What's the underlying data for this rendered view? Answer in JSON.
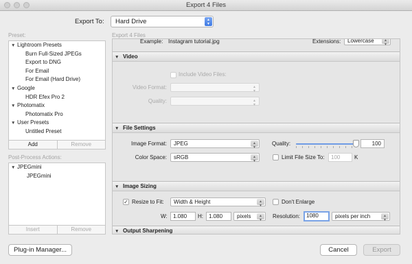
{
  "window": {
    "title": "Export 4 Files"
  },
  "export_to": {
    "label": "Export To:",
    "value": "Hard Drive"
  },
  "preset": {
    "section_label": "Preset:",
    "items": [
      {
        "label": "Lightroom Presets",
        "type": "folder",
        "expanded": true
      },
      {
        "label": "Burn Full-Sized JPEGs",
        "type": "item"
      },
      {
        "label": "Export to DNG",
        "type": "item"
      },
      {
        "label": "For Email",
        "type": "item"
      },
      {
        "label": "For Email (Hard Drive)",
        "type": "item"
      },
      {
        "label": "Google",
        "type": "folder",
        "expanded": true
      },
      {
        "label": "HDR Efex Pro 2",
        "type": "item"
      },
      {
        "label": "Photomatix",
        "type": "folder",
        "expanded": true
      },
      {
        "label": "Photomatix Pro",
        "type": "item"
      },
      {
        "label": "User Presets",
        "type": "folder",
        "expanded": true
      },
      {
        "label": "Untitled Preset",
        "type": "item"
      }
    ],
    "add_label": "Add",
    "remove_label": "Remove"
  },
  "post_process": {
    "section_label": "Post-Process Actions:",
    "items": [
      {
        "label": "JPEGmini",
        "type": "folder",
        "expanded": true
      },
      {
        "label": "JPEGmini",
        "type": "item"
      }
    ],
    "insert_label": "Insert",
    "remove_label": "Remove"
  },
  "right_header": "Export 4 Files",
  "file_naming": {
    "example_label": "Example:",
    "example_value": "Instagram tutorial.jpg",
    "extensions_label": "Extensions:",
    "extensions_value": "Lowercase"
  },
  "video": {
    "title": "Video",
    "include_label": "Include Video Files:",
    "include_checked": false,
    "format_label": "Video Format:",
    "format_value": "",
    "quality_label": "Quality:",
    "quality_value": ""
  },
  "file_settings": {
    "title": "File Settings",
    "image_format_label": "Image Format:",
    "image_format_value": "JPEG",
    "quality_label": "Quality:",
    "quality_value": "100",
    "quality_fraction": 1.0,
    "color_space_label": "Color Space:",
    "color_space_value": "sRGB",
    "limit_label": "Limit File Size To:",
    "limit_checked": false,
    "limit_value": "100",
    "limit_unit": "K"
  },
  "image_sizing": {
    "title": "Image Sizing",
    "resize_label": "Resize to Fit:",
    "resize_checked": true,
    "resize_value": "Width & Height",
    "dont_enlarge_label": "Don't Enlarge",
    "dont_enlarge_checked": false,
    "w_label": "W:",
    "w_value": "1.080",
    "h_label": "H:",
    "h_value": "1.080",
    "unit_value": "pixels",
    "resolution_label": "Resolution:",
    "resolution_value": "1080",
    "resolution_unit": "pixels per inch"
  },
  "output_sharpening": {
    "title": "Output Sharpening"
  },
  "footer": {
    "plugin_manager": "Plug-in Manager...",
    "cancel": "Cancel",
    "export": "Export"
  },
  "colors": {
    "accent": "#3d79e3",
    "focus_ring": "#7aa3e6"
  }
}
